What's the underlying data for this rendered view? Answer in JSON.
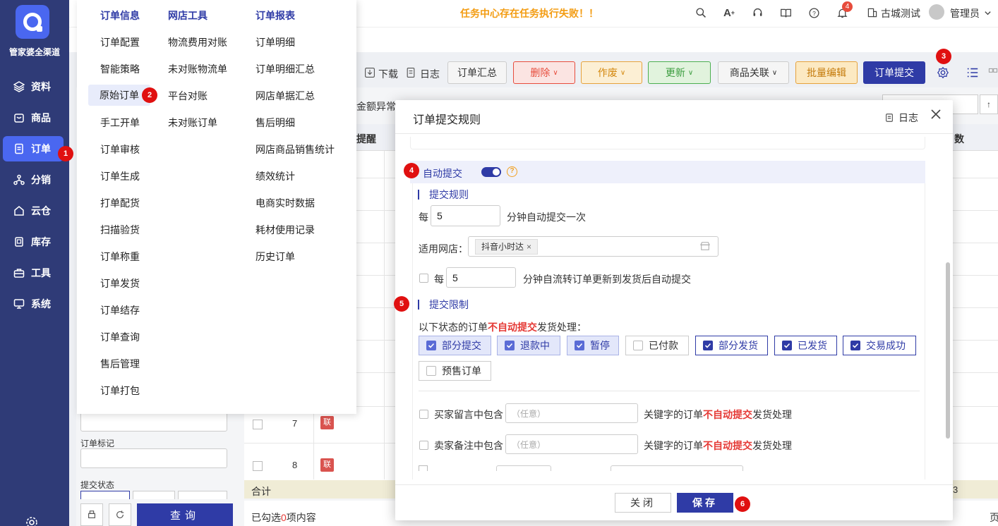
{
  "sidebar": {
    "logo_text": "管家婆全渠道",
    "items": [
      {
        "label": "资料"
      },
      {
        "label": "商品"
      },
      {
        "label": "订单"
      },
      {
        "label": "分销"
      },
      {
        "label": "云仓"
      },
      {
        "label": "库存"
      },
      {
        "label": "工具"
      },
      {
        "label": "系统"
      }
    ]
  },
  "topbar": {
    "alert": "任务中心存在任务执行失败！！",
    "notification_count": "4",
    "shop": "古城测试",
    "user": "管理员"
  },
  "toolbar": {
    "download": "下载",
    "log": "日志",
    "summary": "订单汇总",
    "delete": "删除",
    "void": "作废",
    "update": "更新",
    "product_link": "商品关联",
    "batch_edit": "批量编辑",
    "submit": "订单提交"
  },
  "background": {
    "amount_abnormal": "金额异常",
    "col_remind": "提醒",
    "col_count": "数",
    "row7": "7",
    "row8": "8",
    "lian": "联",
    "order_mark_label": "订单标记",
    "submit_status_label": "提交状态",
    "total_label": "合计",
    "selected_prefix": "已勾选",
    "selected_count": "0",
    "selected_suffix": "项内容",
    "query_btn": "查询",
    "page_num": "3",
    "page_char": "页"
  },
  "menu": {
    "columns": [
      {
        "header": "订单信息",
        "items": [
          "订单配置",
          "智能策略",
          "原始订单",
          "手工开单",
          "订单审核",
          "订单生成",
          "打单配货",
          "扫描验货",
          "订单称重",
          "订单发货",
          "订单结存",
          "订单查询",
          "售后管理",
          "订单打包"
        ]
      },
      {
        "header": "网店工具",
        "items": [
          "物流费用对账",
          "未对账物流单",
          "平台对账",
          "未对账订单"
        ]
      },
      {
        "header": "订单报表",
        "items": [
          "订单明细",
          "订单明细汇总",
          "网店单据汇总",
          "售后明细",
          "网店商品销售统计",
          "绩效统计",
          "电商实时数据",
          "耗材使用记录",
          "历史订单"
        ]
      }
    ]
  },
  "markers": [
    "1",
    "2",
    "3",
    "4",
    "5",
    "6"
  ],
  "modal": {
    "title": "订单提交规则",
    "log": "日志",
    "auto_submit_label": "自动提交",
    "auto_submit_enabled": true,
    "rules_title": "提交规则",
    "every": "每",
    "interval_value": "5",
    "interval_suffix": "分钟自动提交一次",
    "applicable_shops_label": "适用网店：",
    "shop_tag": "抖音小时达",
    "flow_every": "每",
    "flow_value": "5",
    "flow_suffix": "分钟自流转订单更新到发货后自动提交",
    "limit_title": "提交限制",
    "status_line_prefix": "以下状态的订单",
    "status_line_red": "不自动提交",
    "status_line_suffix": "发货处理：",
    "statuses": [
      {
        "label": "部分提交",
        "checked": true
      },
      {
        "label": "退款中",
        "checked": true
      },
      {
        "label": "暂停",
        "checked": true
      },
      {
        "label": "已付款",
        "checked": false
      },
      {
        "label": "部分发货",
        "checked": true
      },
      {
        "label": "已发货",
        "checked": true
      },
      {
        "label": "交易成功",
        "checked": true
      },
      {
        "label": "预售订单",
        "checked": false
      }
    ],
    "buyer_msg_label": "买家留言中包含",
    "seller_note_label": "卖家备注中包含",
    "any_placeholder": "（任意）",
    "keyword_prefix": "关键字的订单",
    "keyword_red": "不自动提交",
    "keyword_suffix": "发货处理",
    "close_btn": "关闭",
    "save_btn": "保存"
  }
}
